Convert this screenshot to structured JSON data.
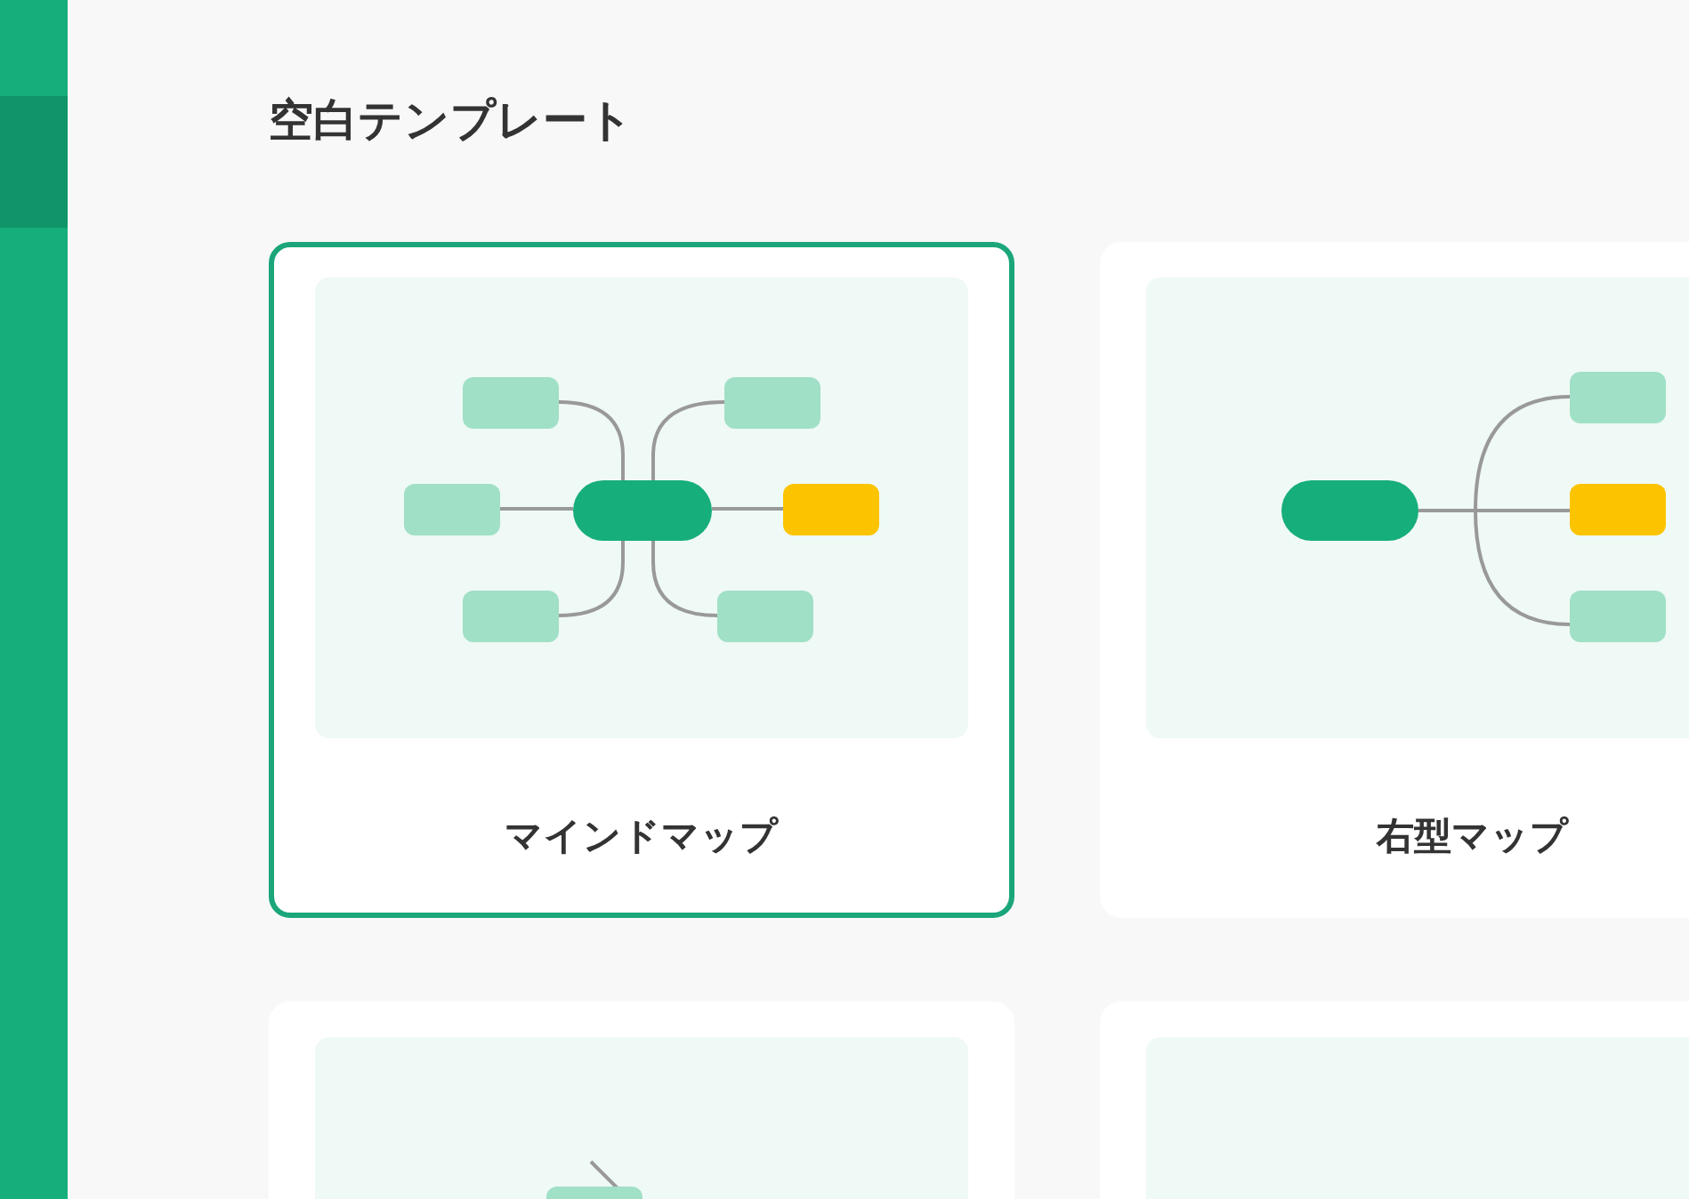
{
  "sidebar": {
    "items": [
      {
        "selected": false
      },
      {
        "selected": true
      },
      {
        "selected": false
      }
    ]
  },
  "section": {
    "title": "空白テンプレート"
  },
  "templates": [
    {
      "kind": "mindmap",
      "label": "マインドマップ",
      "selected": true
    },
    {
      "kind": "right",
      "label": "右型マップ",
      "selected": false
    },
    {
      "kind": "tree",
      "selected": false
    },
    {
      "kind": "blank",
      "selected": false
    }
  ]
}
